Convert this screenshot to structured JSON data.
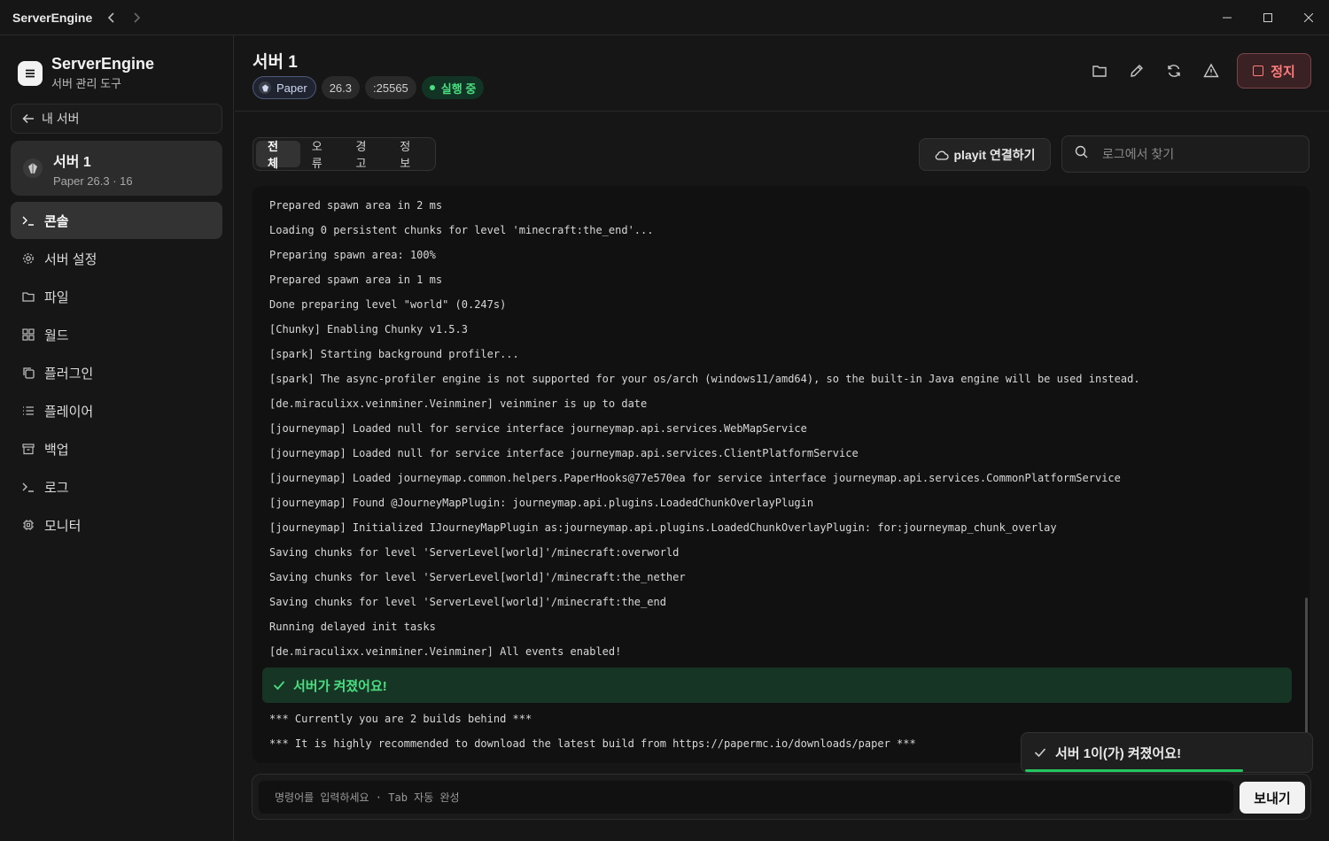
{
  "titlebar": {
    "app_title": "ServerEngine",
    "icons": [
      "chevron-left-icon",
      "chevron-right-icon",
      "minimize-icon",
      "maximize-icon",
      "close-icon"
    ]
  },
  "sidebar": {
    "brand_name": "ServerEngine",
    "brand_subtitle": "서버 관리 도구",
    "back_label": "내 서버",
    "server": {
      "name": "서버 1",
      "meta": "Paper 26.3 · 16"
    },
    "items": [
      {
        "label": "콘솔",
        "icon": "terminal-icon",
        "active": true
      },
      {
        "label": "서버 설정",
        "icon": "gear-icon"
      },
      {
        "label": "파일",
        "icon": "folder-icon"
      },
      {
        "label": "월드",
        "icon": "grid-icon"
      },
      {
        "label": "플러그인",
        "icon": "copy-icon"
      },
      {
        "label": "플레이어",
        "icon": "list-icon"
      },
      {
        "label": "백업",
        "icon": "archive-icon"
      },
      {
        "label": "로그",
        "icon": "terminal-icon"
      },
      {
        "label": "모니터",
        "icon": "cpu-icon"
      }
    ]
  },
  "header": {
    "title": "서버 1",
    "tags": {
      "software": "Paper",
      "version": "26.3",
      "port": ":25565",
      "status": "실행 중"
    },
    "status_color": "#4ade80",
    "stop_label": "정지",
    "actions": [
      "folder-icon",
      "pencil-icon",
      "refresh-icon",
      "alert-triangle-icon"
    ]
  },
  "filters": {
    "tabs": [
      "전체",
      "오류",
      "경고",
      "정보"
    ],
    "active_tab": "전체",
    "playit_label": "playit 연결하기",
    "search_placeholder": "로그에서 찾기"
  },
  "console": {
    "lines": [
      "Prepared spawn area in 2 ms",
      "Loading 0 persistent chunks for level 'minecraft:the_end'...",
      "Preparing spawn area: 100%",
      "Prepared spawn area in 1 ms",
      "Done preparing level \"world\" (0.247s)",
      "[Chunky] Enabling Chunky v1.5.3",
      "[spark] Starting background profiler...",
      "[spark] The async-profiler engine is not supported for your os/arch (windows11/amd64), so the built-in Java engine will be used instead.",
      "[de.miraculixx.veinminer.Veinminer] veinminer is up to date",
      "[journeymap] Loaded null for service interface journeymap.api.services.WebMapService",
      "[journeymap] Loaded null for service interface journeymap.api.services.ClientPlatformService",
      "[journeymap] Loaded journeymap.common.helpers.PaperHooks@77e570ea for service interface journeymap.api.services.CommonPlatformService",
      "[journeymap] Found @JourneyMapPlugin: journeymap.api.plugins.LoadedChunkOverlayPlugin",
      "[journeymap] Initialized IJourneyMapPlugin as:journeymap.api.plugins.LoadedChunkOverlayPlugin: for:journeymap_chunk_overlay",
      "Saving chunks for level 'ServerLevel[world]'/minecraft:overworld",
      "Saving chunks for level 'ServerLevel[world]'/minecraft:the_nether",
      "Saving chunks for level 'ServerLevel[world]'/minecraft:the_end",
      "Running delayed init tasks",
      "[de.miraculixx.veinminer.Veinminer] All events enabled!"
    ],
    "success_message": "서버가 켜졌어요!",
    "after_lines": [
      "*** Currently you are 2 builds behind ***",
      "*** It is highly recommended to download the latest build from https://papermc.io/downloads/paper ***"
    ]
  },
  "toast": {
    "message": "서버 1이(가) 켜졌어요!",
    "progress": 0.75
  },
  "command": {
    "placeholder": "명령어를 입력하세요 · Tab 자동 완성",
    "send_label": "보내기"
  }
}
